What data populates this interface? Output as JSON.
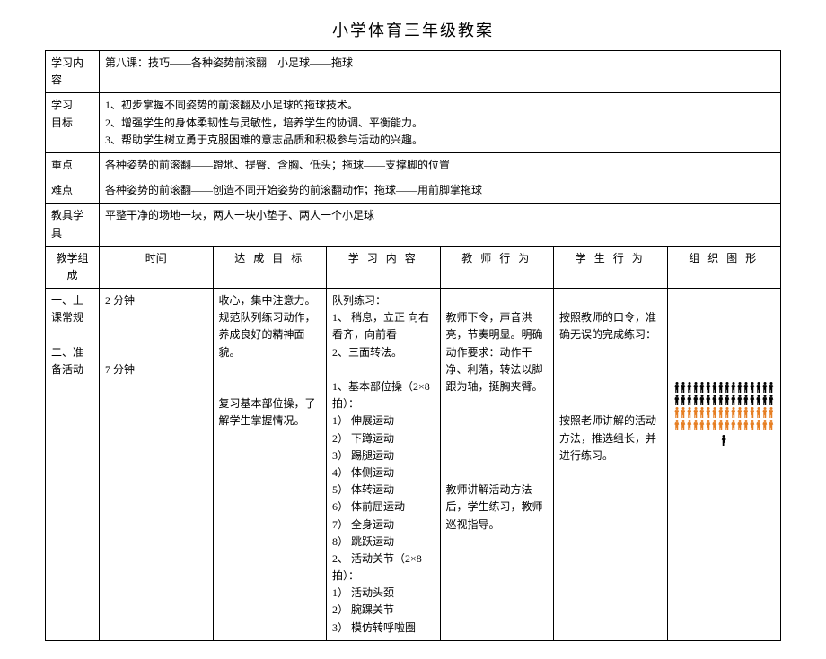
{
  "title": "小学体育三年级教案",
  "labels": {
    "content": "学习内容",
    "objective": "学习\n目标",
    "keypoint": "重点",
    "difficulty": "难点",
    "materials": "教具学具",
    "composition": "教学组成",
    "time": "时间",
    "goal": "达 成 目 标",
    "learnContent": "学 习 内 容",
    "teacher": "教 师 行 为",
    "student": "学 生 行 为",
    "org": "组 织 图 形"
  },
  "header": {
    "content": "第八课：技巧——各种姿势前滚翻　小足球——拖球",
    "objectives": "1、初步掌握不同姿势的前滚翻及小足球的拖球技术。\n2、增强学生的身体柔韧性与灵敏性，培养学生的协调、平衡能力。\n3、帮助学生树立勇于克服困难的意志品质和积极参与活动的兴趣。",
    "keypoint": "各种姿势的前滚翻——蹬地、提臀、含胸、低头；拖球——支撑脚的位置",
    "difficulty": "各种姿势的前滚翻——创造不同开始姿势的前滚翻动作；拖球——用前脚掌拖球",
    "materials": "平整干净的场地一块，两人一块小垫子、两人一个小足球"
  },
  "body": {
    "composition": "一、上课常规\n\n 二、准备活动",
    "time": "2 分钟\n\n\n\n7 分钟",
    "goal": "收心，集中注意力。规范队列练习动作，养成良好的精神面貌。\n\n\n复习基本部位操，了解学生掌握情况。",
    "learnContent": "队列练习：\n1、 稍息，立正 向右看齐，向前看\n2、三面转法。\n\n1、基本部位操（2×8拍）：\n1） 伸展运动\n2） 下蹲运动\n3） 踢腿运动\n4） 体侧运动\n5） 体转运动\n6） 体前屈运动\n7） 全身运动\n8） 跳跃运动\n2、 活动关节（2×8拍）：\n1） 活动头颈\n2） 腕踝关节\n3） 模仿转呼啦圈",
    "teacher": "\n教师下令，声音洪亮，节奏明显。明确动作要求：动作干净、利落，转法以脚跟为轴，挺胸夹臂。\n\n\n\n\n\n教师讲解活动方法后，学生练习，教师巡视指导。",
    "student": "\n按照教师的口令，准确无误的完成练习：\n\n\n\n\n按照老师讲解的活动方法，推选组长，并进行练习。"
  }
}
